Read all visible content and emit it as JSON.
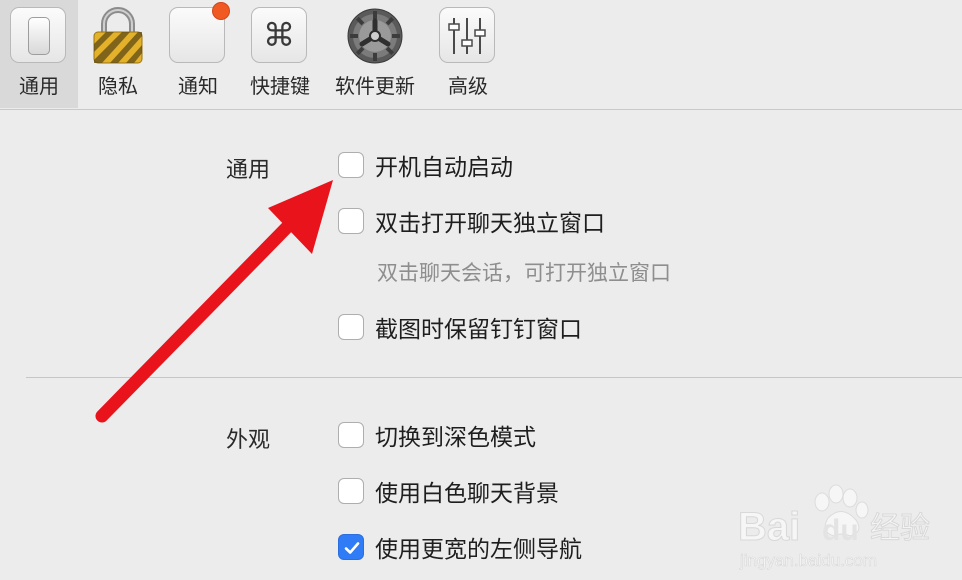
{
  "toolbar": {
    "tabs": [
      {
        "label": "通用",
        "icon": "general-switch-icon",
        "active": true
      },
      {
        "label": "隐私",
        "icon": "padlock-icon",
        "active": false
      },
      {
        "label": "通知",
        "icon": "notification-badge-icon",
        "active": false
      },
      {
        "label": "快捷键",
        "icon": "command-key-icon",
        "active": false
      },
      {
        "label": "软件更新",
        "icon": "gear-update-icon",
        "active": false
      },
      {
        "label": "高级",
        "icon": "sliders-icon",
        "active": false
      }
    ]
  },
  "sections": {
    "general": {
      "label": "通用",
      "options": [
        {
          "label": "开机自动启动",
          "checked": false
        },
        {
          "label": "双击打开聊天独立窗口",
          "checked": false,
          "hint": "双击聊天会话，可打开独立窗口"
        },
        {
          "label": "截图时保留钉钉窗口",
          "checked": false
        }
      ]
    },
    "appearance": {
      "label": "外观",
      "options": [
        {
          "label": "切换到深色模式",
          "checked": false
        },
        {
          "label": "使用白色聊天背景",
          "checked": false
        },
        {
          "label": "使用更宽的左侧导航",
          "checked": true
        }
      ]
    }
  },
  "annotation": {
    "arrow_color": "#e8131b"
  },
  "watermark": {
    "brand": "Bai",
    "brand2": "du",
    "brand_cn": "经验",
    "url": "jingyan.baidu.com"
  },
  "colors": {
    "checkbox_checked": "#2f7cf6",
    "background": "#ececec"
  }
}
